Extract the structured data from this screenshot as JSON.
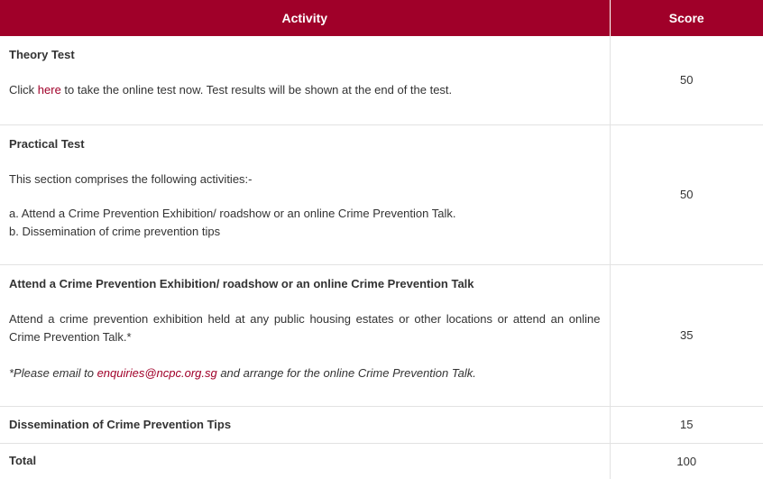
{
  "header": {
    "activity": "Activity",
    "score": "Score"
  },
  "rows": [
    {
      "title": "Theory Test",
      "text_before": "Click ",
      "link": "here",
      "text_after": " to take the online test now. Test results will be shown at the end of the test.",
      "score": "50"
    },
    {
      "title": "Practical Test",
      "intro": "This section comprises the following activities:-",
      "items": [
        "a. Attend a Crime Prevention Exhibition/ roadshow or an online Crime Prevention Talk.",
        "b. Dissemination of crime prevention tips"
      ],
      "score": "50"
    },
    {
      "title": "Attend a Crime Prevention Exhibition/ roadshow or an online Crime Prevention Talk",
      "text": "Attend a crime prevention exhibition held at any public housing estates or other locations or attend an online Crime Prevention Talk.*",
      "note_before": "*Please email to ",
      "email": "enquiries@ncpc.org.sg",
      "note_after": " and arrange for the online Crime Prevention Talk.",
      "score": "35"
    },
    {
      "title": "Dissemination of Crime Prevention Tips",
      "score": "15"
    },
    {
      "title": "Total",
      "score": "100"
    }
  ],
  "colors": {
    "header_bg": "#a00029",
    "link": "#a00029",
    "border": "#e2e2e2"
  }
}
